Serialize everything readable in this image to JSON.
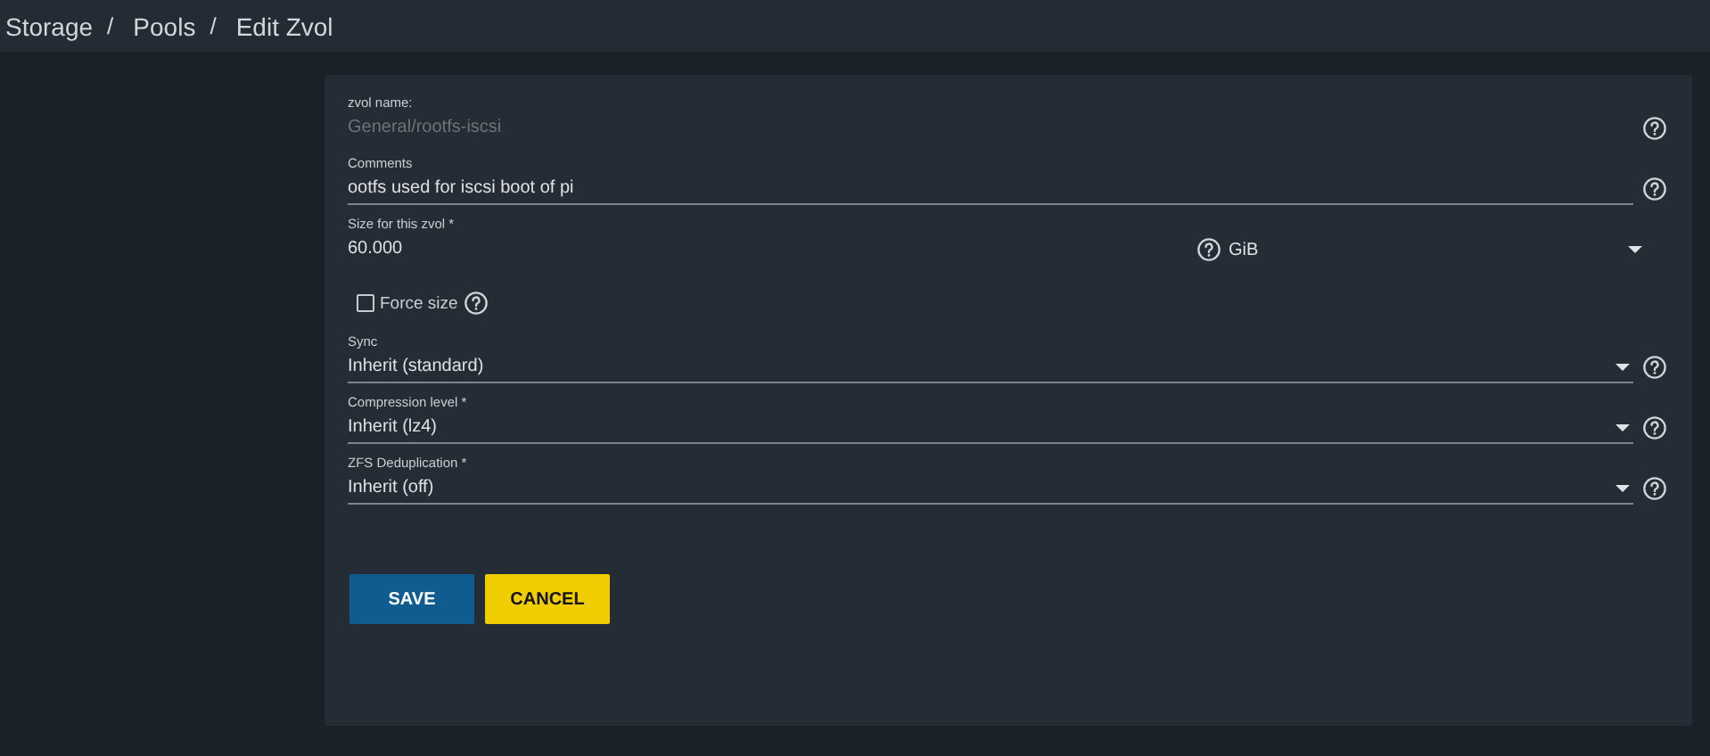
{
  "breadcrumb": [
    {
      "kind": "item",
      "text": "Storage"
    },
    {
      "kind": "separator",
      "text": "/"
    },
    {
      "kind": "item",
      "text": "Pools"
    },
    {
      "kind": "separator",
      "text": "/"
    },
    {
      "kind": "item",
      "text": "Edit Zvol"
    }
  ],
  "fields": [
    {
      "kind": "text",
      "label": "zvol name:",
      "value": "General/rootfs-iscsi",
      "disabled": true,
      "help": true
    },
    {
      "kind": "text",
      "label": "Comments",
      "value": "ootfs used for iscsi boot of pi",
      "disabled": false,
      "help": true
    },
    {
      "kind": "size",
      "label": "Size for this zvol *",
      "value": "60.000",
      "unit": "GiB",
      "help": true
    },
    {
      "kind": "checkbox",
      "label": "Force size",
      "checked": false,
      "help": true
    },
    {
      "kind": "select",
      "label": "Sync",
      "value": "Inherit (standard)",
      "help": true
    },
    {
      "kind": "select",
      "label": "Compression level *",
      "value": "Inherit (lz4)",
      "help": true
    },
    {
      "kind": "select",
      "label": "ZFS Deduplication *",
      "value": "Inherit (off)",
      "help": true
    }
  ],
  "buttons": [
    {
      "kind": "primary",
      "label": "SAVE"
    },
    {
      "kind": "secondary",
      "label": "CANCEL"
    }
  ]
}
